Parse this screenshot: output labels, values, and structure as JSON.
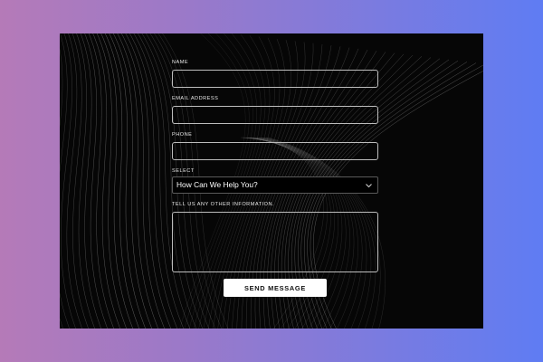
{
  "form": {
    "name_label": "NAME",
    "email_label": "EMAIL ADDRESS",
    "phone_label": "PHONE",
    "select_label": "SELECT",
    "select_value": "How Can We Help You?",
    "message_label": "TELL US ANY OTHER INFORMATION.",
    "send_label": "SEND MESSAGE"
  },
  "colors": {
    "panel_background": "#060606",
    "gradient_left": "#b57ab8",
    "gradient_right": "#5f7cf3",
    "button_background": "#ffffff"
  },
  "icons": {
    "select_arrow": "chevron-down-icon"
  }
}
